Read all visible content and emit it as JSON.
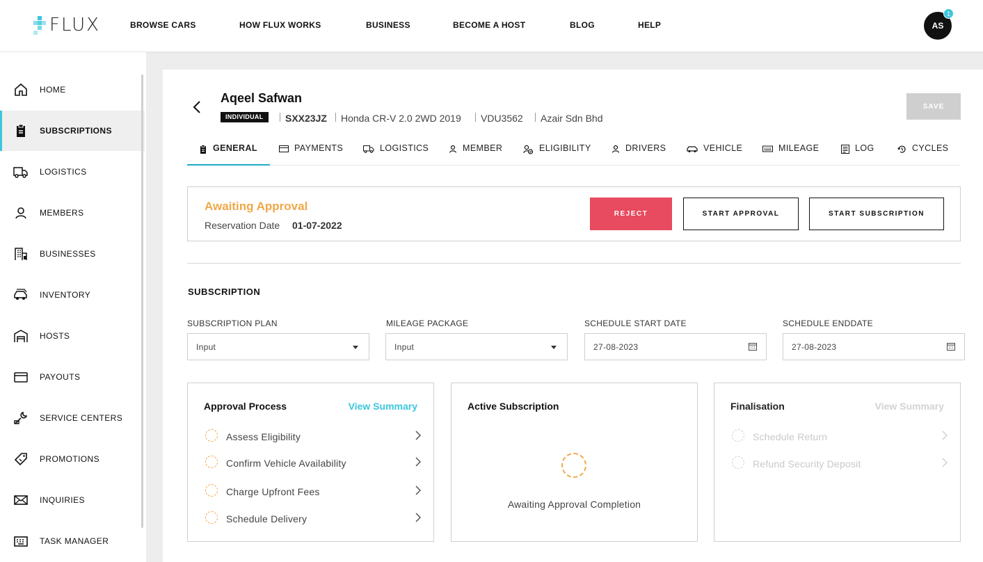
{
  "brand": {
    "name": "FLUX",
    "accent": "#3cc7dd"
  },
  "topnav": {
    "items": [
      "BROWSE CARS",
      "HOW FLUX WORKS",
      "BUSINESS",
      "BECOME A HOST",
      "BLOG",
      "HELP"
    ],
    "avatar_initials": "AS",
    "notification_count": "1"
  },
  "sidebar": {
    "items": [
      {
        "label": "HOME",
        "icon": "home-icon"
      },
      {
        "label": "SUBSCRIPTIONS",
        "icon": "clipboard-icon",
        "active": true
      },
      {
        "label": "LOGISTICS",
        "icon": "truck-icon"
      },
      {
        "label": "MEMBERS",
        "icon": "user-icon"
      },
      {
        "label": "BUSINESSES",
        "icon": "building-icon"
      },
      {
        "label": "INVENTORY",
        "icon": "car-icon"
      },
      {
        "label": "HOSTS",
        "icon": "garage-icon"
      },
      {
        "label": "PAYOUTS",
        "icon": "card-icon"
      },
      {
        "label": "SERVICE CENTERS",
        "icon": "wrench-icon"
      },
      {
        "label": "PROMOTIONS",
        "icon": "tag-icon"
      },
      {
        "label": "INQUIRIES",
        "icon": "mail-icon"
      },
      {
        "label": "TASK MANAGER",
        "icon": "keyboard-icon"
      }
    ]
  },
  "header": {
    "name": "Aqeel Safwan",
    "tag": "INDIVIDUAL",
    "plate": "SXX23JZ",
    "vehicle": "Honda CR-V 2.0 2WD 2019",
    "code": "VDU3562",
    "company": "Azair Sdn Bhd",
    "save_label": "SAVE"
  },
  "tabs": [
    {
      "label": "GENERAL",
      "icon": "clipboard-icon",
      "active": true
    },
    {
      "label": "PAYMENTS",
      "icon": "card-icon"
    },
    {
      "label": "LOGISTICS",
      "icon": "truck-icon"
    },
    {
      "label": "MEMBER",
      "icon": "user-icon"
    },
    {
      "label": "ELIGIBILITY",
      "icon": "user-check-icon"
    },
    {
      "label": "DRIVERS",
      "icon": "user-icon"
    },
    {
      "label": "VEHICLE",
      "icon": "car-icon"
    },
    {
      "label": "MILEAGE",
      "icon": "odometer-icon"
    },
    {
      "label": "LOG",
      "icon": "list-icon"
    },
    {
      "label": "CYCLES",
      "icon": "cycle-icon"
    }
  ],
  "status": {
    "title": "Awaiting Approval",
    "reservation_label": "Reservation Date",
    "reservation_date": "01-07-2022",
    "reject_label": "REJECT",
    "start_approval_label": "START APPROVAL",
    "start_subscription_label": "START SUBSCRIPTION"
  },
  "subscription": {
    "title": "SUBSCRIPTION",
    "fields": [
      {
        "label": "SUBSCRIPTION PLAN",
        "value": "Input",
        "type": "select"
      },
      {
        "label": "MILEAGE PACKAGE",
        "value": "Input",
        "type": "select"
      },
      {
        "label": "SCHEDULE START DATE",
        "value": "27-08-2023",
        "type": "date"
      },
      {
        "label": "SCHEDULE ENDDATE",
        "value": "27-08-2023",
        "type": "date"
      }
    ]
  },
  "cards": {
    "approval": {
      "title": "Approval Process",
      "link": "View Summary",
      "steps": [
        "Assess Eligibility",
        "Confirm Vehicle Availability",
        "Charge Upfront Fees",
        "Schedule Delivery"
      ]
    },
    "active": {
      "title": "Active Subscription",
      "status": "Awaiting Approval Completion"
    },
    "finalisation": {
      "title": "Finalisation",
      "link": "View Summary",
      "steps": [
        "Schedule Return",
        "Refund Security Deposit"
      ]
    }
  },
  "colors": {
    "pending": "#f0a848",
    "reject": "#e84a5f",
    "active_tab": "#1fa9c4"
  }
}
